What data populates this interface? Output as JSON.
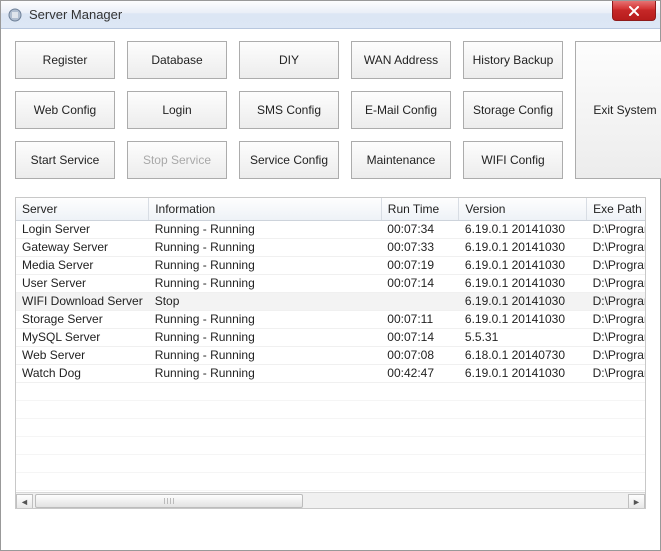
{
  "window": {
    "title": "Server Manager"
  },
  "buttons": {
    "register": "Register",
    "database": "Database",
    "diy": "DIY",
    "wan_address": "WAN Address",
    "history_backup": "History Backup",
    "web_config": "Web Config",
    "login": "Login",
    "sms_config": "SMS Config",
    "email_config": "E-Mail Config",
    "storage_config": "Storage Config",
    "start_service": "Start Service",
    "stop_service": "Stop Service",
    "service_config": "Service Config",
    "maintenance": "Maintenance",
    "wifi_config": "WIFI Config",
    "exit_system": "Exit System"
  },
  "table": {
    "headers": {
      "server": "Server",
      "information": "Information",
      "runtime": "Run Time",
      "version": "Version",
      "exe_path": "Exe Path"
    },
    "rows": [
      {
        "server": "Login Server",
        "info": "Running - Running",
        "runtime": "00:07:34",
        "version": "6.19.0.1 20141030",
        "exe": "D:\\Program"
      },
      {
        "server": "Gateway Server",
        "info": "Running - Running",
        "runtime": "00:07:33",
        "version": "6.19.0.1 20141030",
        "exe": "D:\\Program"
      },
      {
        "server": "Media Server",
        "info": "Running - Running",
        "runtime": "00:07:19",
        "version": "6.19.0.1 20141030",
        "exe": "D:\\Program"
      },
      {
        "server": "User Server",
        "info": "Running - Running",
        "runtime": "00:07:14",
        "version": "6.19.0.1 20141030",
        "exe": "D:\\Program"
      },
      {
        "server": "WIFI Download Server",
        "info": "Stop",
        "runtime": "",
        "version": "6.19.0.1 20141030",
        "exe": "D:\\Program"
      },
      {
        "server": "Storage Server",
        "info": "Running - Running",
        "runtime": "00:07:11",
        "version": "6.19.0.1 20141030",
        "exe": "D:\\Program"
      },
      {
        "server": "MySQL Server",
        "info": "Running - Running",
        "runtime": "00:07:14",
        "version": "5.5.31",
        "exe": "D:\\Program"
      },
      {
        "server": "Web Server",
        "info": "Running - Running",
        "runtime": "00:07:08",
        "version": "6.18.0.1 20140730",
        "exe": "D:\\Program"
      },
      {
        "server": "Watch Dog",
        "info": "Running - Running",
        "runtime": "00:42:47",
        "version": "6.19.0.1 20141030",
        "exe": "D:\\Program"
      }
    ],
    "selected_index": 4
  }
}
